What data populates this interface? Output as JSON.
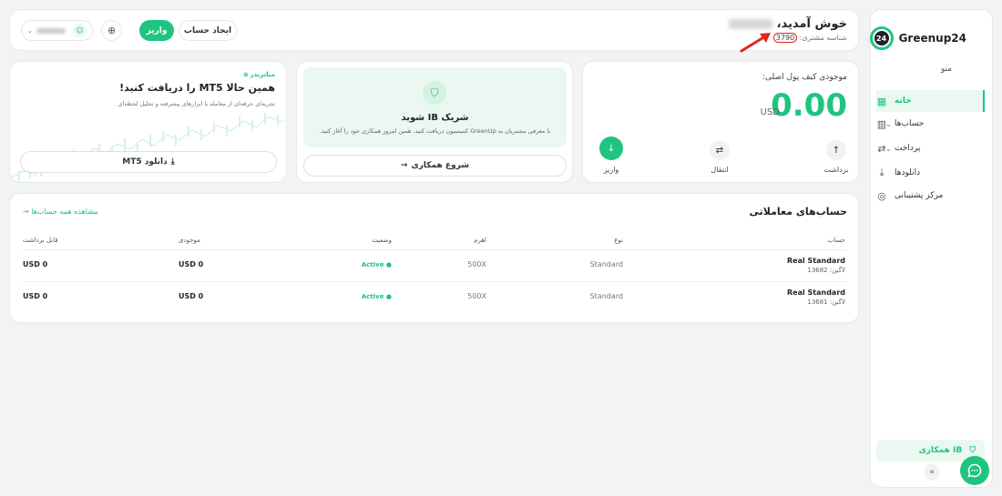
{
  "brand": {
    "name": "Greenup24",
    "badge": "24"
  },
  "sidebar": {
    "menu_title": "منو",
    "items": [
      {
        "label": "خانه",
        "icon": "grid-icon",
        "glyph": "▦",
        "active": true,
        "chevron": false
      },
      {
        "label": "حساب‌ها",
        "icon": "bar-chart-icon",
        "glyph": "▥",
        "active": false,
        "chevron": true
      },
      {
        "label": "پرداخت",
        "icon": "transfer-icon",
        "glyph": "⇄",
        "active": false,
        "chevron": true
      },
      {
        "label": "دانلودها",
        "icon": "download-icon",
        "glyph": "⤓",
        "active": false,
        "chevron": false
      },
      {
        "label": "مرکز پشتیبانی",
        "icon": "support-icon",
        "glyph": "◎",
        "active": false,
        "chevron": false
      }
    ],
    "ib_label": "همکاری IB",
    "collapse_glyph": "«"
  },
  "header": {
    "welcome": "خوش آمدید،",
    "client_id_label": "شناسه مشتری:",
    "client_id": "3790",
    "deposit_label": "واریز",
    "create_account_label": "ایجاد حساب"
  },
  "wallet": {
    "title": "موجودی کیف پول اصلی:",
    "amount": "0.00",
    "currency": "USD",
    "actions": {
      "withdraw": "برداشت",
      "transfer": "انتقال",
      "deposit": "واریز"
    }
  },
  "ib": {
    "title": "شریک IB شوید",
    "description": "با معرفی مشتریان به GreenUp کمیسیون دریافت کنید. همین امروز همکاری خود را آغاز کنید.",
    "button": "شروع همکاری"
  },
  "mt5": {
    "tag": "متاتریدر ۵",
    "title": "همین حالا MT5 را دریافت کنید!",
    "description": "تجربه‌ای حرفه‌ای از معامله با ابزارهای پیشرفته و تحلیل لحظه‌ای",
    "button": "دانلود MT5"
  },
  "accounts": {
    "title": "حساب‌های معاملاتی",
    "view_all": "مشاهده همه حساب‌ها",
    "columns": {
      "account": "حساب",
      "type": "نوع",
      "leverage": "اهرم",
      "status": "وضعیت",
      "balance": "موجودی",
      "withdrawable": "قابل برداشت"
    },
    "rows": [
      {
        "name": "Real Standard",
        "login": "لاگین: 13682",
        "type": "Standard",
        "leverage": "500X",
        "status": "Active",
        "balance": "USD 0",
        "withdrawable": "USD 0"
      },
      {
        "name": "Real Standard",
        "login": "لاگین: 13681",
        "type": "Standard",
        "leverage": "500X",
        "status": "Active",
        "balance": "USD 0",
        "withdrawable": "USD 0"
      }
    ]
  },
  "colors": {
    "accent": "#1fc57e",
    "annotation": "#e0261b"
  }
}
